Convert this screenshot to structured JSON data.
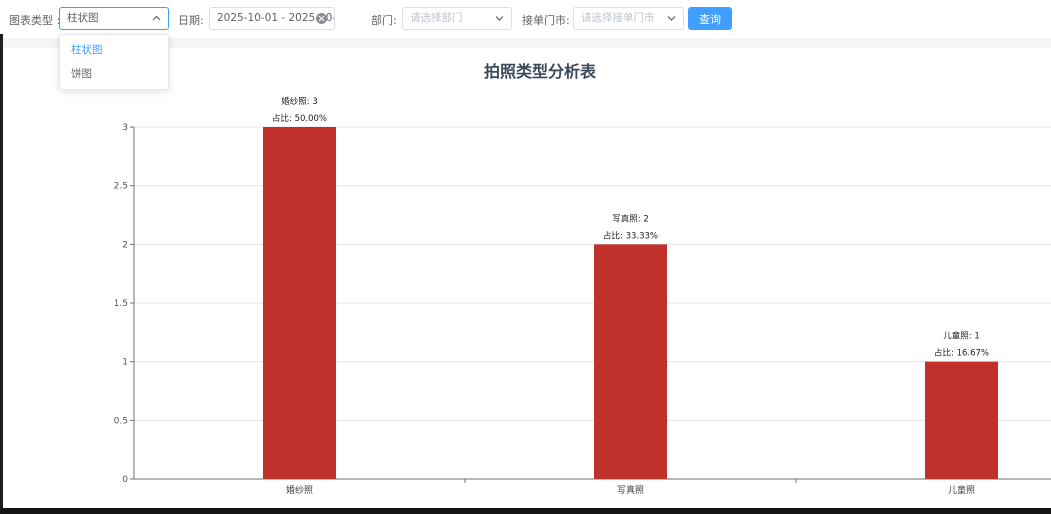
{
  "filters": {
    "chart_type_label": "图表类型 :",
    "chart_type_value": "柱状图",
    "date_label": "日期:",
    "date_value": "2025-10-01 - 2025-10-31",
    "department_label": "部门:",
    "department_placeholder": "请选择部门",
    "order_city_label": "接单门市:",
    "order_city_placeholder": "请选择接单门市",
    "query_button": "查询"
  },
  "chart_type_options": [
    "柱状图",
    "饼图"
  ],
  "colors": {
    "bar": "#c1312c",
    "accent": "#409eff"
  },
  "chart_data": {
    "type": "bar",
    "title": "拍照类型分析表",
    "categories": [
      "婚纱照",
      "写真照",
      "儿童照"
    ],
    "values": [
      3,
      2,
      1
    ],
    "annotations": [
      [
        "婚纱照: 3",
        "占比: 50.00%"
      ],
      [
        "写真照: 2",
        "占比: 33.33%"
      ],
      [
        "儿童照: 1",
        "占比: 16.67%"
      ]
    ],
    "yticks": [
      "0",
      "0.5",
      "1",
      "1.5",
      "2",
      "2.5",
      "3"
    ],
    "ylim": [
      0,
      3
    ],
    "grid": true
  }
}
